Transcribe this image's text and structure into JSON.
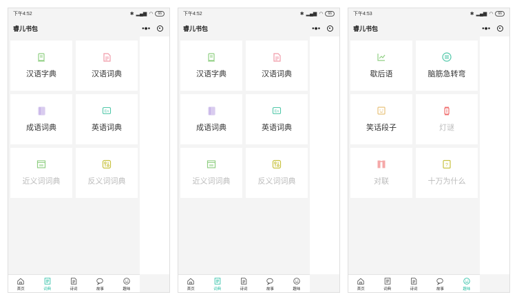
{
  "colors": {
    "accent": "#2bbfa5",
    "page_bg": "#f4f4f4",
    "tile_bg": "#ffffff",
    "faded_text": "#bbbbbb"
  },
  "screens": [
    {
      "time": "下午4:52",
      "battery": "66",
      "app_title": "睿儿书包",
      "active_tab": 1,
      "tiles": [
        {
          "label": "汉语字典",
          "icon": "book-icon",
          "color": "#8fcf82",
          "faded": false
        },
        {
          "label": "汉语词典",
          "icon": "document-icon",
          "color": "#f09aa8",
          "faded": false
        },
        {
          "label": "成语词典",
          "icon": "notebook-icon",
          "color": "#b59be0",
          "faded": false
        },
        {
          "label": "英语词典",
          "icon": "en-icon",
          "color": "#4fc7a8",
          "faded": false
        },
        {
          "label": "近义词词典",
          "icon": "synonym-icon",
          "color": "#8fcf82",
          "faded": true
        },
        {
          "label": "反义词词典",
          "icon": "antonym-icon",
          "color": "#c8c240",
          "faded": true
        }
      ]
    },
    {
      "time": "下午4:52",
      "battery": "66",
      "app_title": "睿儿书包",
      "active_tab": 1,
      "tiles": [
        {
          "label": "汉语字典",
          "icon": "book-icon",
          "color": "#8fcf82",
          "faded": false
        },
        {
          "label": "汉语词典",
          "icon": "document-icon",
          "color": "#f09aa8",
          "faded": false
        },
        {
          "label": "成语词典",
          "icon": "notebook-icon",
          "color": "#b59be0",
          "faded": false
        },
        {
          "label": "英语词典",
          "icon": "en-icon",
          "color": "#4fc7a8",
          "faded": false
        },
        {
          "label": "近义词词典",
          "icon": "synonym-icon",
          "color": "#8fcf82",
          "faded": true
        },
        {
          "label": "反义词词典",
          "icon": "antonym-icon",
          "color": "#c8c240",
          "faded": true
        }
      ]
    },
    {
      "time": "下午4:53",
      "battery": "66",
      "app_title": "睿儿书包",
      "active_tab": 4,
      "tiles": [
        {
          "label": "歇后语",
          "icon": "chart-icon",
          "color": "#8fcf82",
          "faded": false
        },
        {
          "label": "脑筋急转弯",
          "icon": "menu-circle-icon",
          "color": "#4fc7a8",
          "faded": false
        },
        {
          "label": "笑话段子",
          "icon": "smile-icon",
          "color": "#e8c27a",
          "faded": false
        },
        {
          "label": "灯谜",
          "icon": "lantern-icon",
          "color": "#f07070",
          "faded": true
        },
        {
          "label": "对联",
          "icon": "couplet-icon",
          "color": "#f07070",
          "faded": true
        },
        {
          "label": "十万为什么",
          "icon": "question-icon",
          "color": "#c8c240",
          "faded": true
        }
      ]
    }
  ],
  "tabs": [
    {
      "label": "首页",
      "icon": "home-icon"
    },
    {
      "label": "词典",
      "icon": "dictionary-icon"
    },
    {
      "label": "诗词",
      "icon": "poem-icon"
    },
    {
      "label": "故事",
      "icon": "story-icon"
    },
    {
      "label": "趣味",
      "icon": "fun-icon"
    }
  ]
}
